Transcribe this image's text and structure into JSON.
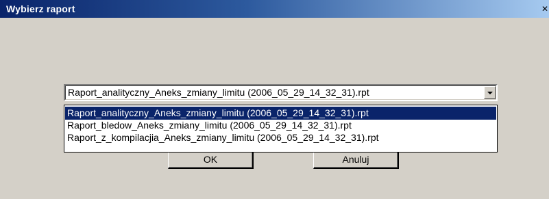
{
  "window": {
    "title": "Wybierz raport",
    "close_glyph": "✕"
  },
  "combo": {
    "selected_value": "Raport_analityczny_Aneks_zmiany_limitu (2006_05_29_14_32_31).rpt",
    "arrow_icon": "chevron-down-icon"
  },
  "dropdown": {
    "options": [
      "Raport_analityczny_Aneks_zmiany_limitu (2006_05_29_14_32_31).rpt",
      "Raport_bledow_Aneks_zmiany_limitu (2006_05_29_14_32_31).rpt",
      "Raport_z_kompilacjia_Aneks_zmiany_limitu (2006_05_29_14_32_31).rpt"
    ],
    "selected_index": 0
  },
  "buttons": {
    "ok_label": "OK",
    "cancel_label": "Anuluj"
  },
  "colors": {
    "selection_bg": "#0a246a",
    "face": "#d4d0c8",
    "title_gradient_start": "#0a246a",
    "title_gradient_end": "#a6caf0"
  }
}
